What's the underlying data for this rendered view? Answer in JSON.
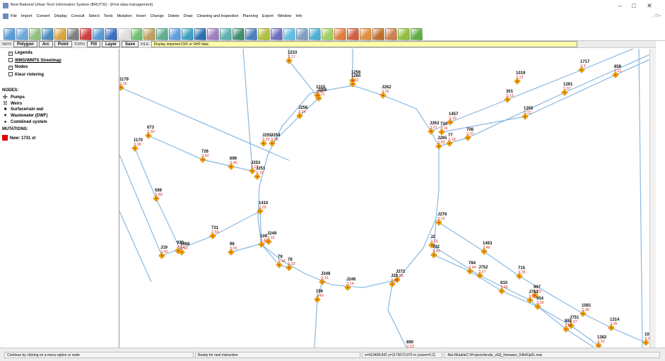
{
  "window": {
    "title": "Best Rational Urban Tech Information System (BRUTIS) - [First data management]",
    "minimize": "–",
    "maximize": "□",
    "close": "✕",
    "mdi_controls": "_ ❐ ×"
  },
  "menu": [
    "File",
    "Import",
    "Convert",
    "Display",
    "Consult",
    "Select",
    "Tools",
    "Mutation",
    "Insert",
    "Change",
    "Delete",
    "Draw",
    "Cleaning and Inspection",
    "Planning",
    "Export",
    "Window",
    "Info"
  ],
  "toolbar": {
    "icons": [
      {
        "name": "zoom-icon",
        "color": "#5a9bd5"
      },
      {
        "name": "zoom-window-icon",
        "color": "#6fa8dc"
      },
      {
        "name": "pan-icon",
        "color": "#8fbf7f"
      },
      {
        "name": "globe-icon",
        "color": "#4f8fbf"
      },
      {
        "name": "palette-icon",
        "color": "#d9a441"
      },
      {
        "name": "select-icon",
        "color": "#7f7f7f"
      },
      {
        "name": "layers-icon",
        "color": "#d04040"
      },
      {
        "name": "grid-icon",
        "color": "#5a9bd5"
      },
      {
        "name": "network-icon",
        "color": "#3f6fbf"
      },
      {
        "name": "window-icon",
        "color": "#e0e0e0"
      },
      {
        "name": "tree-icon",
        "color": "#6fbf6f"
      },
      {
        "name": "print-icon",
        "color": "#bf9f5f"
      },
      {
        "name": "stats-icon",
        "color": "#5faf8f"
      },
      {
        "name": "refresh-icon",
        "color": "#5f9fdf"
      },
      {
        "name": "info-icon",
        "color": "#3f9fbf"
      },
      {
        "name": "chart-icon",
        "color": "#2f6faf"
      },
      {
        "name": "pipe-icon",
        "color": "#9f7fbf"
      },
      {
        "name": "node-icon",
        "color": "#5fafaf"
      },
      {
        "name": "camera-icon",
        "color": "#3f8f6f"
      },
      {
        "name": "search-icon",
        "color": "#4f7fbf"
      },
      {
        "name": "edit-icon",
        "color": "#afbf3f"
      },
      {
        "name": "link-icon",
        "color": "#6f6fbf"
      },
      {
        "name": "measure-icon",
        "color": "#5fbfdf"
      },
      {
        "name": "tool-icon",
        "color": "#7f9fbf"
      },
      {
        "name": "export-icon",
        "color": "#4fafcf"
      },
      {
        "name": "report-icon",
        "color": "#9fcf5f"
      },
      {
        "name": "warning-icon",
        "color": "#df7f3f"
      },
      {
        "name": "danger-icon",
        "color": "#cf5f3f"
      },
      {
        "name": "mark-icon",
        "color": "#df8f3f"
      },
      {
        "name": "flag-icon",
        "color": "#bf6f2f"
      },
      {
        "name": "check-icon",
        "color": "#cf7f4f"
      },
      {
        "name": "settings-icon",
        "color": "#8fbf3f"
      },
      {
        "name": "ok-icon",
        "color": "#5faf3f"
      }
    ]
  },
  "modes": {
    "info_label": "INFO",
    "polygon": "Polygon",
    "arc": "Arc",
    "point": "Point",
    "topo_label": "TOPO",
    "fill": "Fill",
    "layer": "Layer",
    "save": "Save",
    "file_label": "FILE",
    "message": "Display imported DXF or SHP data"
  },
  "legend": {
    "checkboxes": [
      {
        "label": "Legenda",
        "checked": true
      },
      {
        "label": "WMS/WMTS Streetmap",
        "checked": false
      },
      {
        "label": "Nodes",
        "checked": true
      },
      {
        "label": "Kleur riolering",
        "checked": false
      }
    ],
    "nodes_title": "NODES:",
    "node_types": [
      {
        "symbol": "➕",
        "label": "Pumps"
      },
      {
        "symbol": "☷",
        "label": "Weirs"
      },
      {
        "symbol": "■",
        "label": "Surface/rain wat"
      },
      {
        "symbol": "▼",
        "label": "Wastewater (DWF)"
      },
      {
        "symbol": "●",
        "label": "Combined system"
      }
    ],
    "mutations_title": "MUTATIONS:",
    "mutation": "New: 1731 st",
    "mutation_color": "#e00000"
  },
  "map": {
    "pipe_color": "#8ab8e0",
    "node_color": "#f0b400",
    "nodes": [
      {
        "id": "1233",
        "val": "3.17"
      },
      {
        "id": "1256",
        "val": ""
      },
      {
        "id": "1260",
        "val": "3.22"
      },
      {
        "id": "1179",
        "val": "3.16"
      },
      {
        "id": "1315",
        "val": "3.68"
      },
      {
        "id": "J258",
        "val": "3.21"
      },
      {
        "id": "J262",
        "val": "3.26"
      },
      {
        "id": "1717",
        "val": "3.2"
      },
      {
        "id": "859",
        "val": "3.21"
      },
      {
        "id": "1019",
        "val": "3.22"
      },
      {
        "id": "1291",
        "val": "3.37"
      },
      {
        "id": "301",
        "val": "3.13"
      },
      {
        "id": "1355",
        "val": "3.22"
      },
      {
        "id": "1457",
        "val": "3.19"
      },
      {
        "id": "J256",
        "val": "3.24"
      },
      {
        "id": "J263",
        "val": "3.07"
      },
      {
        "id": "734",
        "val": "3.16"
      },
      {
        "id": "708",
        "val": "3.37"
      },
      {
        "id": "77",
        "val": "3.18"
      },
      {
        "id": "J265",
        "val": "3.05"
      },
      {
        "id": "673",
        "val": "3.30"
      },
      {
        "id": "1170",
        "val": "3.38"
      },
      {
        "id": "J255",
        "val": "3.25"
      },
      {
        "id": "J254",
        "val": "3.26"
      },
      {
        "id": "726",
        "val": "3.42"
      },
      {
        "id": "699",
        "val": "3.46"
      },
      {
        "id": "J253",
        "val": "3.22"
      },
      {
        "id": "J251",
        "val": "3.19"
      },
      {
        "id": "589",
        "val": "3.48"
      },
      {
        "id": "1410",
        "val": "3.29"
      },
      {
        "id": "J276",
        "val": "3.12"
      },
      {
        "id": "731",
        "val": "2.59"
      },
      {
        "id": "J249",
        "val": "3.15"
      },
      {
        "id": "109",
        "val": "3.40"
      },
      {
        "id": "920",
        "val": "3.41"
      },
      {
        "id": "1468",
        "val": "3.42"
      },
      {
        "id": "98",
        "val": "3.55"
      },
      {
        "id": "J19",
        "val": "3.43"
      },
      {
        "id": "79",
        "val": "3.14"
      },
      {
        "id": "78",
        "val": "3.33"
      },
      {
        "id": "1493",
        "val": "3.46"
      },
      {
        "id": "J2",
        "val": "3.16"
      },
      {
        "id": "742",
        "val": "3.43"
      },
      {
        "id": "784",
        "val": "3.44"
      },
      {
        "id": "J752",
        "val": "3.27"
      },
      {
        "id": "715",
        "val": "3.35"
      },
      {
        "id": "J271",
        "val": "3.08"
      },
      {
        "id": "J248",
        "val": "3.15"
      },
      {
        "id": "J246",
        "val": "3.14"
      },
      {
        "id": "J25",
        "val": "3.43"
      },
      {
        "id": "810",
        "val": "3.45"
      },
      {
        "id": "967",
        "val": "3.29"
      },
      {
        "id": "J753",
        "val": "3.26"
      },
      {
        "id": "954",
        "val": "3.39"
      },
      {
        "id": "1081",
        "val": "3.38"
      },
      {
        "id": "156",
        "val": "3.49"
      },
      {
        "id": "J751",
        "val": "3.37"
      },
      {
        "id": "882",
        "val": "3.57"
      },
      {
        "id": "1314",
        "val": "3.35"
      },
      {
        "id": "1382",
        "val": "3.32"
      },
      {
        "id": "890",
        "val": "3.33"
      },
      {
        "id": "109",
        "val": "3.32"
      }
    ]
  },
  "statusbar": {
    "hint": "Continue by clicking on a menu option or node",
    "ready": "Ready for next instruction",
    "coords": "x=410458.842 y=1173073.970 m (zoom=0.2)",
    "file": "-Net-MutatieC:\\Projects\\brutis_v62j_freeware_64b\\Kip01.mut"
  }
}
